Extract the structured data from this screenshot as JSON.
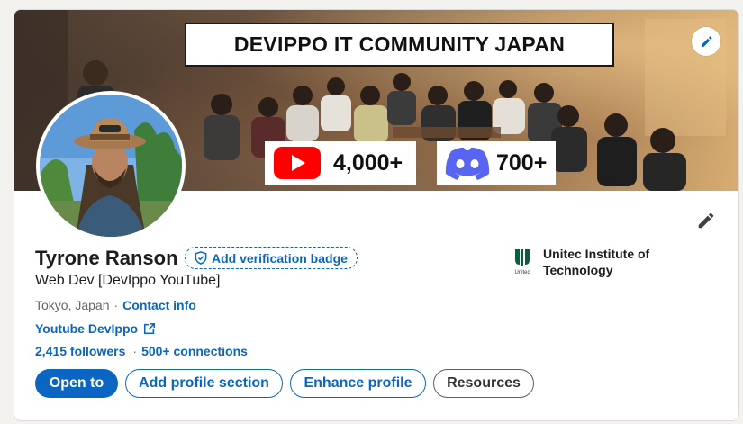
{
  "banner": {
    "title": "DEVIPPO IT COMMUNITY JAPAN",
    "youtube_count": "4,000+",
    "discord_count": "700+",
    "youtube_icon": "youtube-logo-icon",
    "discord_icon": "discord-logo-icon",
    "edit_icon": "pencil-icon"
  },
  "profile": {
    "name": "Tyrone Ranson",
    "verify_label": "Add verification badge",
    "headline": "Web Dev [DevIppo YouTube]",
    "location": "Tokyo, Japan",
    "separator": "·",
    "contact_label": "Contact info",
    "website_label": "Youtube DevIppo",
    "followers": "2,415 followers",
    "connections": "500+ connections",
    "edit_icon": "pencil-icon"
  },
  "education": {
    "school_name": "Unitec Institute of Technology",
    "logo_text": "Unitec"
  },
  "actions": {
    "open_to": "Open to",
    "add_section": "Add profile section",
    "enhance": "Enhance profile",
    "resources": "Resources"
  },
  "colors": {
    "accent": "#0a66c2",
    "page_bg": "#f4f2ee",
    "youtube_red": "#ff0000",
    "discord_blurple": "#5865f2"
  }
}
